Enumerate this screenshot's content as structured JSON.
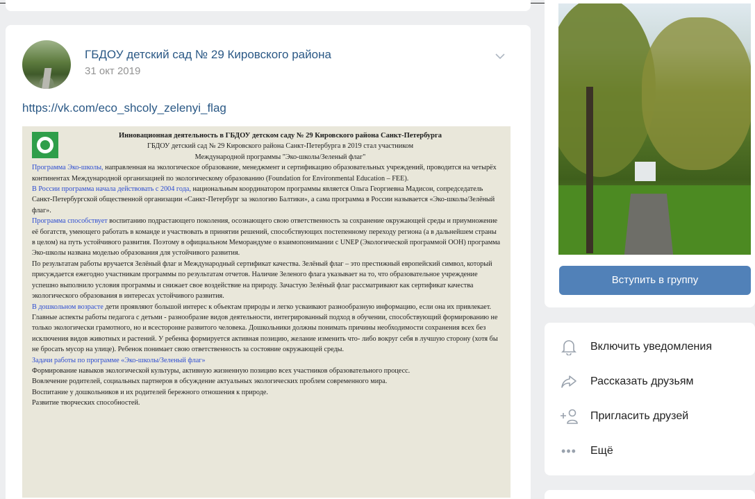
{
  "post": {
    "author": "ГБДОУ детский сад № 29 Кировского района",
    "date": "31 окт 2019",
    "link": "https://vk.com/eco_shcoly_zelenyi_flag"
  },
  "document": {
    "heading": "Инновационная деятельность в ГБДОУ детском саду № 29 Кировского района Санкт-Петербурга",
    "subheading1": "ГБДОУ детский сад № 29 Кировского района Санкт-Петербурга в 2019  стал участником",
    "subheading2": "Международной программы \"Эко-школы/Зеленый флаг\"",
    "p1_highlight": " Программа Эко-школы,",
    "p1_text": " направленная на экологическое образование, менеджмент и сертификацию образовательных учреждений, проводится на четырёх континентах Международной организацией по экологическому образованию (Foundation for Environmental Education – FEE).",
    "p2_highlight": "В России программа начала действовать с 2004 года,",
    "p2_text": " национальным координатором программы является Ольга Георгиевна Мадисон, сопредседатель Санкт-Петербургской общественной организации «Санкт-Петербург за экологию Балтики», а сама программа в России называется «Эко-школы/Зелёный флаг».",
    "p3_highlight": "Программа способствует",
    "p3_text": " воспитанию подрастающего поколения, осознающего свою ответственность за сохранение окружающей среды и приумножение её богатств, умеющего работать в команде и участвовать в принятии решений, способствующих постепенному переходу региона (а в дальнейшем страны в целом) на путь устойчивого развития. Поэтому в официальном Меморандуме о взаимопонимании с UNEP (Экологической программой ООН) программа Эко-школы названа моделью образования для устойчивого развития.",
    "p4_text": "По результатам работы вручается Зелёный флаг и Международный сертификат качества. Зелёный флаг – это престижный европейский символ, который присуждается ежегодно участникам программы по результатам отчетов. Наличие Зеленого флага указывает на то, что образовательное учреждение успешно выполнило условия программы и снижает свое воздействие на природу. Зачастую Зелёный флаг рассматривают как сертификат качества экологического образования в интересах устойчивого развития.",
    "p5_highlight": "В дошкольном возрасте",
    "p5_text": " дети проявляют большой интерес к объектам природы и легко усваивают разнообразную информацию, если она их привлекает. Главные аспекты работы педагога с детьми - разнообразие видов деятельности, интегрированный подход в обучении, способствующий формированию не только экологически грамотного, но и всесторонне развитого человека. Дошкольники должны понимать причины необходимости сохранения всех без исключения видов животных и растений. У ребенка формируется активная позицию, желание изменить что- либо вокруг себя в лучшую сторону (хотя бы не бросать мусор на улице). Ребенок понимает свою ответственность за состояние окружающей среды.",
    "p6_highlight": "Задачи работы по программе «Эко-школы/Зеленый флаг»",
    "list": [
      "Формирование навыков экологической культуры, активную жизненную позицию всех участников образовательного процесс.",
      "Вовлечение родителей, социальных партнеров в обсуждение актуальных экологических проблем современного мира.",
      "Воспитание у дошкольников и их родителей бережного отношения к природе.",
      "Развитие творческих способностей."
    ]
  },
  "sidebar": {
    "join_label": "Вступить в группу",
    "actions": [
      {
        "label": "Включить уведомления",
        "icon": "bell-icon"
      },
      {
        "label": "Рассказать друзьям",
        "icon": "share-icon"
      },
      {
        "label": "Пригласить друзей",
        "icon": "add-friend-icon"
      },
      {
        "label": "Ещё",
        "icon": "more-icon"
      }
    ]
  },
  "colors": {
    "link": "#2a5885",
    "button": "#5181b8",
    "background": "#edeef0",
    "doc_highlight": "#2b4bd1"
  }
}
